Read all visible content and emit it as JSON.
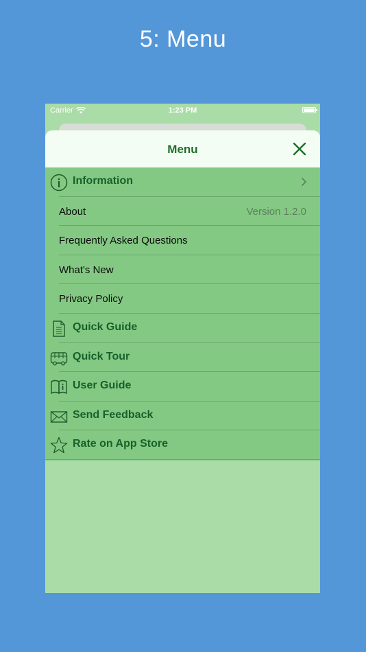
{
  "page": {
    "title": "5: Menu"
  },
  "status_bar": {
    "carrier": "Carrier",
    "time": "1:23 PM"
  },
  "nav": {
    "title": "Menu"
  },
  "menu": {
    "information": {
      "label": "Information",
      "icon": "info-circle-icon",
      "items": [
        {
          "label": "About",
          "detail": "Version 1.2.0"
        },
        {
          "label": "Frequently Asked Questions"
        },
        {
          "label": "What's New"
        },
        {
          "label": "Privacy Policy"
        }
      ]
    },
    "sections": [
      {
        "label": "Quick Guide",
        "icon": "document-icon"
      },
      {
        "label": "Quick Tour",
        "icon": "bus-icon"
      },
      {
        "label": "User Guide",
        "icon": "book-icon"
      },
      {
        "label": "Send Feedback",
        "icon": "envelope-icon"
      },
      {
        "label": "Rate on App Store",
        "icon": "star-icon"
      }
    ]
  },
  "colors": {
    "background": "#5397d9",
    "screen": "#aadca8",
    "menu_rows": "#84c983",
    "nav_bar": "#f4fdf3",
    "accent_green": "#1e6e2b"
  }
}
